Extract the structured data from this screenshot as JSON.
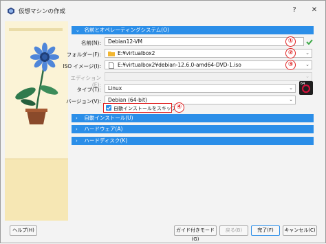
{
  "window": {
    "title": "仮想マシンの作成",
    "help_glyph": "?",
    "close_glyph": "✕"
  },
  "sections": {
    "name_os": "名前とオペレーティングシステム(O)",
    "unattended": "自動インストール(U)",
    "hardware": "ハードウェア(A)",
    "harddisk": "ハードディスク(K)"
  },
  "form": {
    "name_label": "名前(N):",
    "name_value": "Debian12-VM",
    "folder_label": "フォルダー(F):",
    "folder_value": "E:¥virtualbox2",
    "iso_label": "ISO イメージ(I):",
    "iso_value": "E:¥virtualbox2¥debian-12.6.0-amd64-DVD-1.iso",
    "edition_label": "エディション(E):",
    "type_label": "タイプ(T):",
    "type_value": "Linux",
    "version_label": "バージョン(V):",
    "version_value": "Debian (64-bit)",
    "skip_unattended_label": "自動インストールをスキップ(S)",
    "skip_unattended_checked": true
  },
  "annotations": [
    "①",
    "②",
    "③",
    "④"
  ],
  "buttons": {
    "help": "ヘルプ(H)",
    "guided_mode": "ガイド付きモード(G)",
    "back": "戻る(B)",
    "finish": "完了(F)",
    "cancel": "キャンセル(C)"
  },
  "os_badge": "64",
  "colors": {
    "accent": "#2b8ee8",
    "annotation": "#e02020",
    "valid_check": "#3aa845"
  }
}
